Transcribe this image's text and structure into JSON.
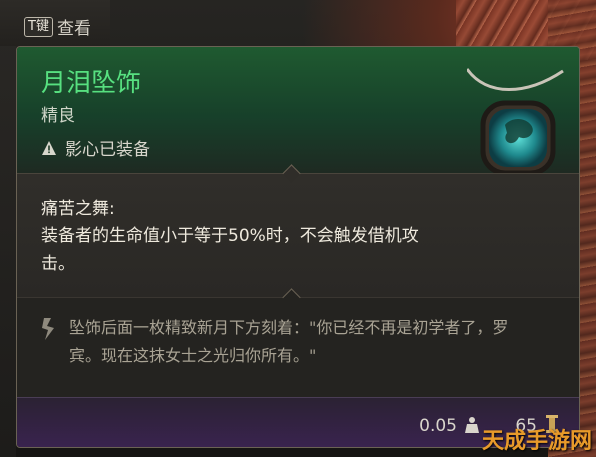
{
  "hud": {
    "key_label": "T键",
    "key_action": "查看"
  },
  "item": {
    "name": "月泪坠饰",
    "rarity": "精良",
    "equip_status": "影心已装备",
    "passive_title": "痛苦之舞:",
    "passive_text": "装备者的生命值小于等于50%时，不会触发借机攻击。",
    "lore": "坠饰后面一枚精致新月下方刻着：\"你已经不再是初学者了，罗宾。现在这抹女士之光归你所有。\"",
    "weight": "0.05",
    "value": "65"
  },
  "colors": {
    "title": "#57e080",
    "header_bg": "#1f5a30",
    "footer_bg": "#3a2350"
  },
  "icons": [
    "warning-icon",
    "lore-quill-icon",
    "weight-icon",
    "gold-coin-icon"
  ],
  "watermark": "天成手游网"
}
